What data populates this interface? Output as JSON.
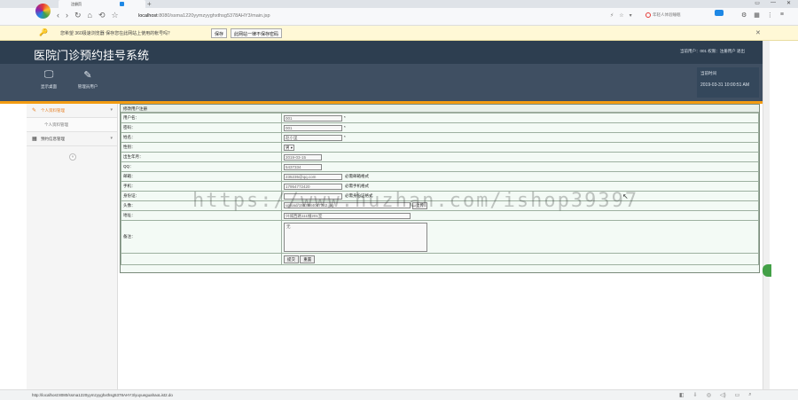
{
  "browser": {
    "tab_title": "注册页",
    "new_tab": "+",
    "window_controls": [
      "▭",
      "—",
      "✕"
    ],
    "url_host": "localhost",
    "url_path": ":8080/ssma1220yymzyyghxthsg5378AHY3/main.jsp",
    "search_placeholder": "年轻人体验睡眠",
    "cloud_label": "",
    "toolbar_icons": [
      "⚙",
      "▦",
      "⋮",
      "≡"
    ],
    "address_right_icons": [
      "⚡",
      "☆",
      "▾"
    ]
  },
  "password_bar": {
    "message": "您希望 360极速浏览器 保存您在此网站上使用的帐号吗？",
    "save_label": "保存",
    "never_label": "此网站一律不保存密码",
    "close": "✕"
  },
  "app": {
    "title": "医院门诊预约挂号系统",
    "user_info": "当前用户：001 权限：注册用户 退出",
    "tools": [
      {
        "label": "显示桌面",
        "icon": "monitor-icon"
      },
      {
        "label": "管理员用户",
        "icon": "pencil-icon"
      }
    ],
    "time_label": "当前时间",
    "time_value": "2019-03-31 10:00:51 AM"
  },
  "sidebar": {
    "items": [
      {
        "label": "个人资料管理"
      },
      {
        "label": "个人资料管理"
      },
      {
        "label": "预约信息管理"
      }
    ]
  },
  "form": {
    "title": "修改用户注册",
    "fields": {
      "username": {
        "label": "用户名：",
        "value": "001",
        "mark": "*"
      },
      "password": {
        "label": "密码：",
        "value": "001",
        "mark": "*"
      },
      "name": {
        "label": "姓名：",
        "value": "赵小里",
        "mark": "*"
      },
      "gender": {
        "label": "性别：",
        "value": "男 ▾"
      },
      "birthdate": {
        "label": "出生年月：",
        "value": "2019-03-15"
      },
      "qq": {
        "label": "QQ：",
        "value": "5437334"
      },
      "email": {
        "label": "邮箱：",
        "value": "235235@qq.com",
        "hint": "必需邮箱格式"
      },
      "phone": {
        "label": "手机：",
        "value": "17954772420",
        "hint": "必需手机格式"
      },
      "idcard": {
        "label": "身份证：",
        "value": "",
        "hint": "必需身份证格式"
      },
      "avatar": {
        "label": "头像：",
        "value": "upload/1553984047762.jpg",
        "button": "上传"
      },
      "address": {
        "label": "地址：",
        "value": "兴城西路111幢201室"
      },
      "remark": {
        "label": "备注：",
        "value": "无"
      }
    },
    "submit_label": "提交",
    "reset_label": "重置"
  },
  "watermark": "https://www.huzhan.com/ishop39397",
  "status": {
    "url": "http://localhost:8080/ssma1220yymzyyghxthsg5378AHY3/yuyueguahaoList2.do",
    "icons": [
      "◧",
      "⇩",
      "◎",
      "◁)",
      "▭",
      "⌕"
    ]
  }
}
